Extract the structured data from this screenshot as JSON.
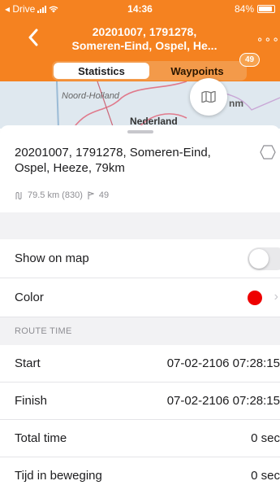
{
  "status_bar": {
    "carrier": "◂ Drive",
    "time": "14:36",
    "battery": "84%"
  },
  "header": {
    "title_line1": "20201007, 1791278,",
    "title_line2": "Someren-Eind, Ospel, He...",
    "more_label": "∘∘∘",
    "back_icon": "chevron-left"
  },
  "tabs": [
    {
      "label": "Statistics",
      "active": true
    },
    {
      "label": "Waypoints",
      "active": false
    }
  ],
  "waypoints_badge": "49",
  "map": {
    "label_region": "Noord-Holland",
    "label_country": "Nederland",
    "label_partial": "nm"
  },
  "route": {
    "name": "20201007, 1791278, Someren-Eind, Ospel, Heeze, 79km",
    "distance": "79.5 km (830)",
    "waypoints": "49"
  },
  "settings": {
    "show_on_map_label": "Show on map",
    "show_on_map_enabled": false,
    "color_label": "Color",
    "color_value": "#ee0000"
  },
  "route_time": {
    "section_label": "ROUTE TIME",
    "rows": [
      {
        "label": "Start",
        "value": "07-02-2106 07:28:15"
      },
      {
        "label": "Finish",
        "value": "07-02-2106 07:28:15"
      },
      {
        "label": "Total time",
        "value": "0 sec"
      },
      {
        "label": "Tijd in beweging",
        "value": "0 sec"
      }
    ]
  },
  "colors": {
    "accent": "#f58220",
    "route_color": "#ee0000"
  }
}
